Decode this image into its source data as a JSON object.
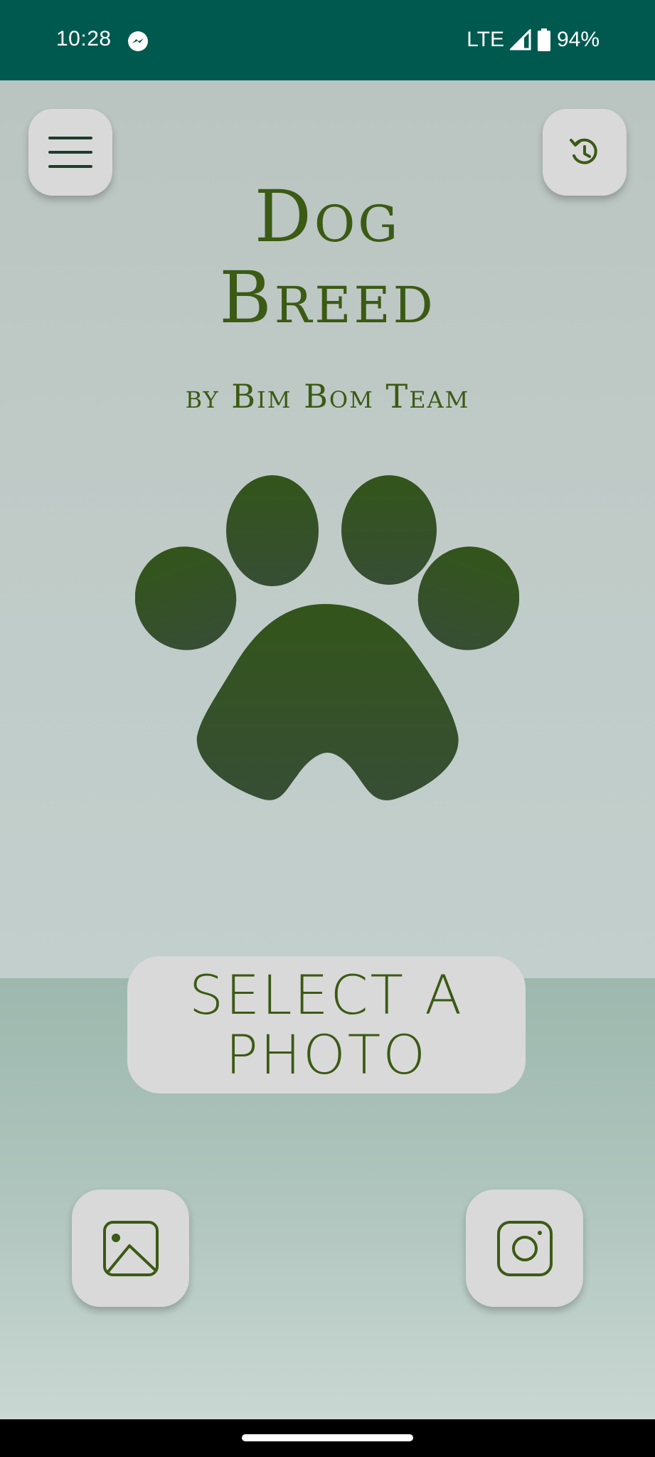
{
  "status_bar": {
    "time": "10:28",
    "network": "LTE",
    "battery": "94%",
    "icons": [
      "messenger-icon",
      "signal-icon",
      "battery-icon"
    ]
  },
  "header": {
    "menu_icon": "hamburger-menu-icon",
    "history_icon": "history-icon"
  },
  "title": {
    "line1": "Dog",
    "line2": "Breed",
    "subtitle": "by Bim Bom Team"
  },
  "logo_icon": "paw-print-icon",
  "select_button": {
    "line1": "SELECT A",
    "line2": "PHOTO"
  },
  "bottom_actions": {
    "gallery_icon": "image-gallery-icon",
    "camera_icon": "camera-icon"
  },
  "colors": {
    "status_bar": "#00594f",
    "accent": "#3b5a14",
    "button_bg": "#d9d9d9",
    "paw": "#33551c"
  }
}
